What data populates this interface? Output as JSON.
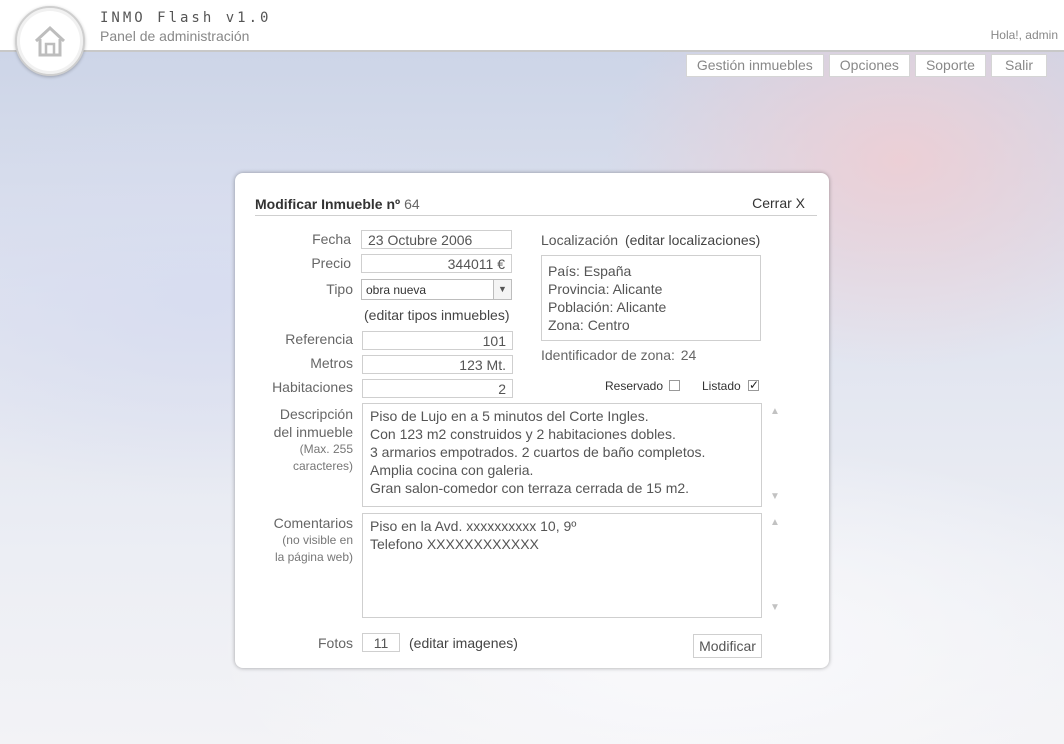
{
  "header": {
    "app_title": "INMO Flash v1.0",
    "app_subtitle": "Panel de administración",
    "greeting": "Hola!, admin",
    "logo_icon": "house-icon"
  },
  "nav": {
    "items": [
      "Gestión inmuebles",
      "Opciones",
      "Soporte",
      "Salir"
    ]
  },
  "form": {
    "title": "Modificar Inmueble nº",
    "number": "64",
    "close_label": "Cerrar X",
    "fecha_label": "Fecha",
    "fecha_value": "23 Octubre 2006",
    "precio_label": "Precio",
    "precio_value": "344011  €",
    "tipo_label": "Tipo",
    "tipo_value": "obra nueva",
    "edit_tipos": "(editar tipos inmuebles)",
    "referencia_label": "Referencia",
    "referencia_value": "101",
    "metros_label": "Metros",
    "metros_value": "123  Mt.",
    "habitaciones_label": "Habitaciones",
    "habitaciones_value": "2",
    "localizacion_label": "Localización",
    "edit_localizaciones": "(editar localizaciones)",
    "location": {
      "pais": "País: España",
      "provincia": "Provincia: Alicante",
      "poblacion": "Población: Alicante",
      "zona": "Zona: Centro"
    },
    "zona_id_label": "Identificador de zona:",
    "zona_id_value": "24",
    "reservado_label": "Reservado",
    "reservado_checked": false,
    "listado_label": "Listado",
    "listado_checked": true,
    "descripcion_label_1": "Descripción",
    "descripcion_label_2": "del inmueble",
    "descripcion_note_1": "(Max. 255",
    "descripcion_note_2": "caracteres)",
    "descripcion_lines": [
      "Piso de Lujo en a 5 minutos del Corte Ingles.",
      "Con 123 m2 construidos y 2 habitaciones dobles.",
      "3 armarios empotrados. 2 cuartos de baño completos.",
      "Amplia cocina con galeria.",
      "Gran salon-comedor con terraza cerrada de 15 m2."
    ],
    "comentarios_label": "Comentarios",
    "comentarios_note_1": "(no visible en",
    "comentarios_note_2": "la página web)",
    "comentarios_lines": [
      "Piso en la Avd. xxxxxxxxxx 10, 9º",
      "Telefono XXXXXXXXXXXX"
    ],
    "fotos_label": "Fotos",
    "fotos_value": "11",
    "edit_imagenes": "(editar imagenes)",
    "submit_label": "Modificar",
    "check_mark": "✓",
    "select_arrow": "▼",
    "scroll_up": "▲",
    "scroll_down": "▼"
  }
}
